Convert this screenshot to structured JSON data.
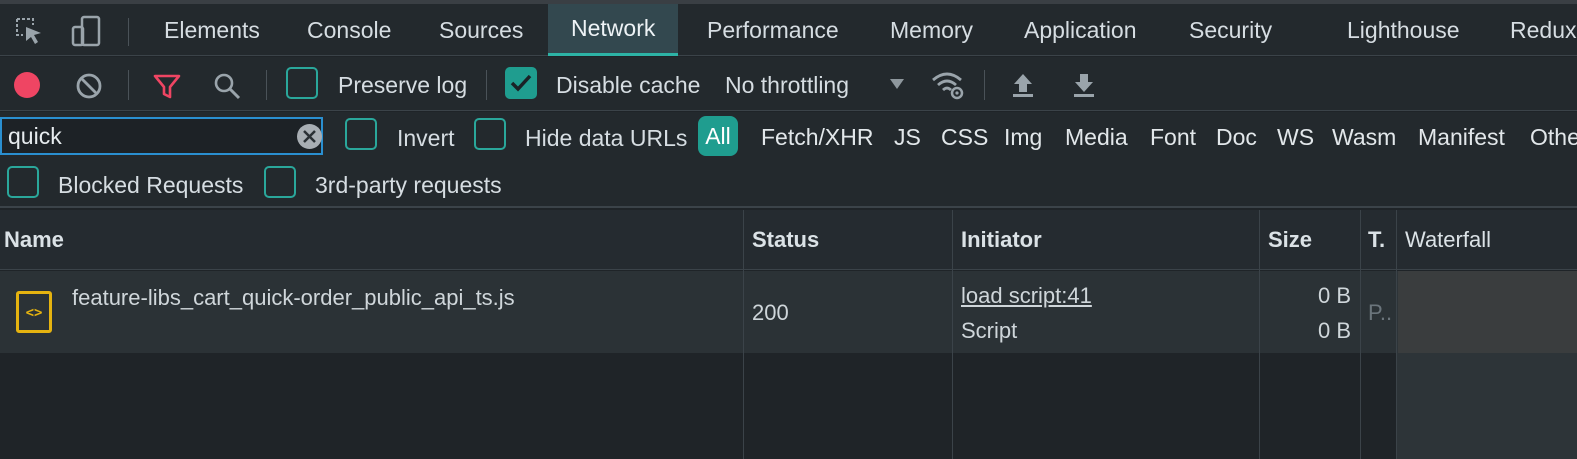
{
  "tabs": [
    {
      "label": "Elements"
    },
    {
      "label": "Console"
    },
    {
      "label": "Sources"
    },
    {
      "label": "Network"
    },
    {
      "label": "Performance"
    },
    {
      "label": "Memory"
    },
    {
      "label": "Application"
    },
    {
      "label": "Security"
    },
    {
      "label": "Lighthouse"
    },
    {
      "label": "Redux"
    }
  ],
  "active_tab": "Network",
  "toolbar": {
    "preserve_log_label": "Preserve log",
    "preserve_log_checked": false,
    "disable_cache_label": "Disable cache",
    "disable_cache_checked": true,
    "throttling_value": "No throttling",
    "record_color": "#ef4563",
    "filter_icon_color": "#ef4563"
  },
  "filter": {
    "search_value": "quick",
    "invert_label": "Invert",
    "hide_data_urls_label": "Hide data URLs",
    "types": [
      "All",
      "Fetch/XHR",
      "JS",
      "CSS",
      "Img",
      "Media",
      "Font",
      "Doc",
      "WS",
      "Wasm",
      "Manifest",
      "Other"
    ],
    "blocked_requests_label": "Blocked Requests",
    "third_party_label": "3rd-party requests"
  },
  "table": {
    "columns": {
      "name": "Name",
      "status": "Status",
      "initiator": "Initiator",
      "size": "Size",
      "time": "T.",
      "waterfall": "Waterfall"
    },
    "rows": [
      {
        "name": "feature-libs_cart_quick-order_public_api_ts.js",
        "status": "200",
        "initiator_link": "load script:41",
        "initiator_type": "Script",
        "size_transferred": "0 B",
        "size_resource": "0 B",
        "time": "P..."
      }
    ]
  },
  "colors": {
    "accent": "#1f9d8f",
    "active_tab_underline": "#2db3a6",
    "file_icon": "#e5b310"
  }
}
